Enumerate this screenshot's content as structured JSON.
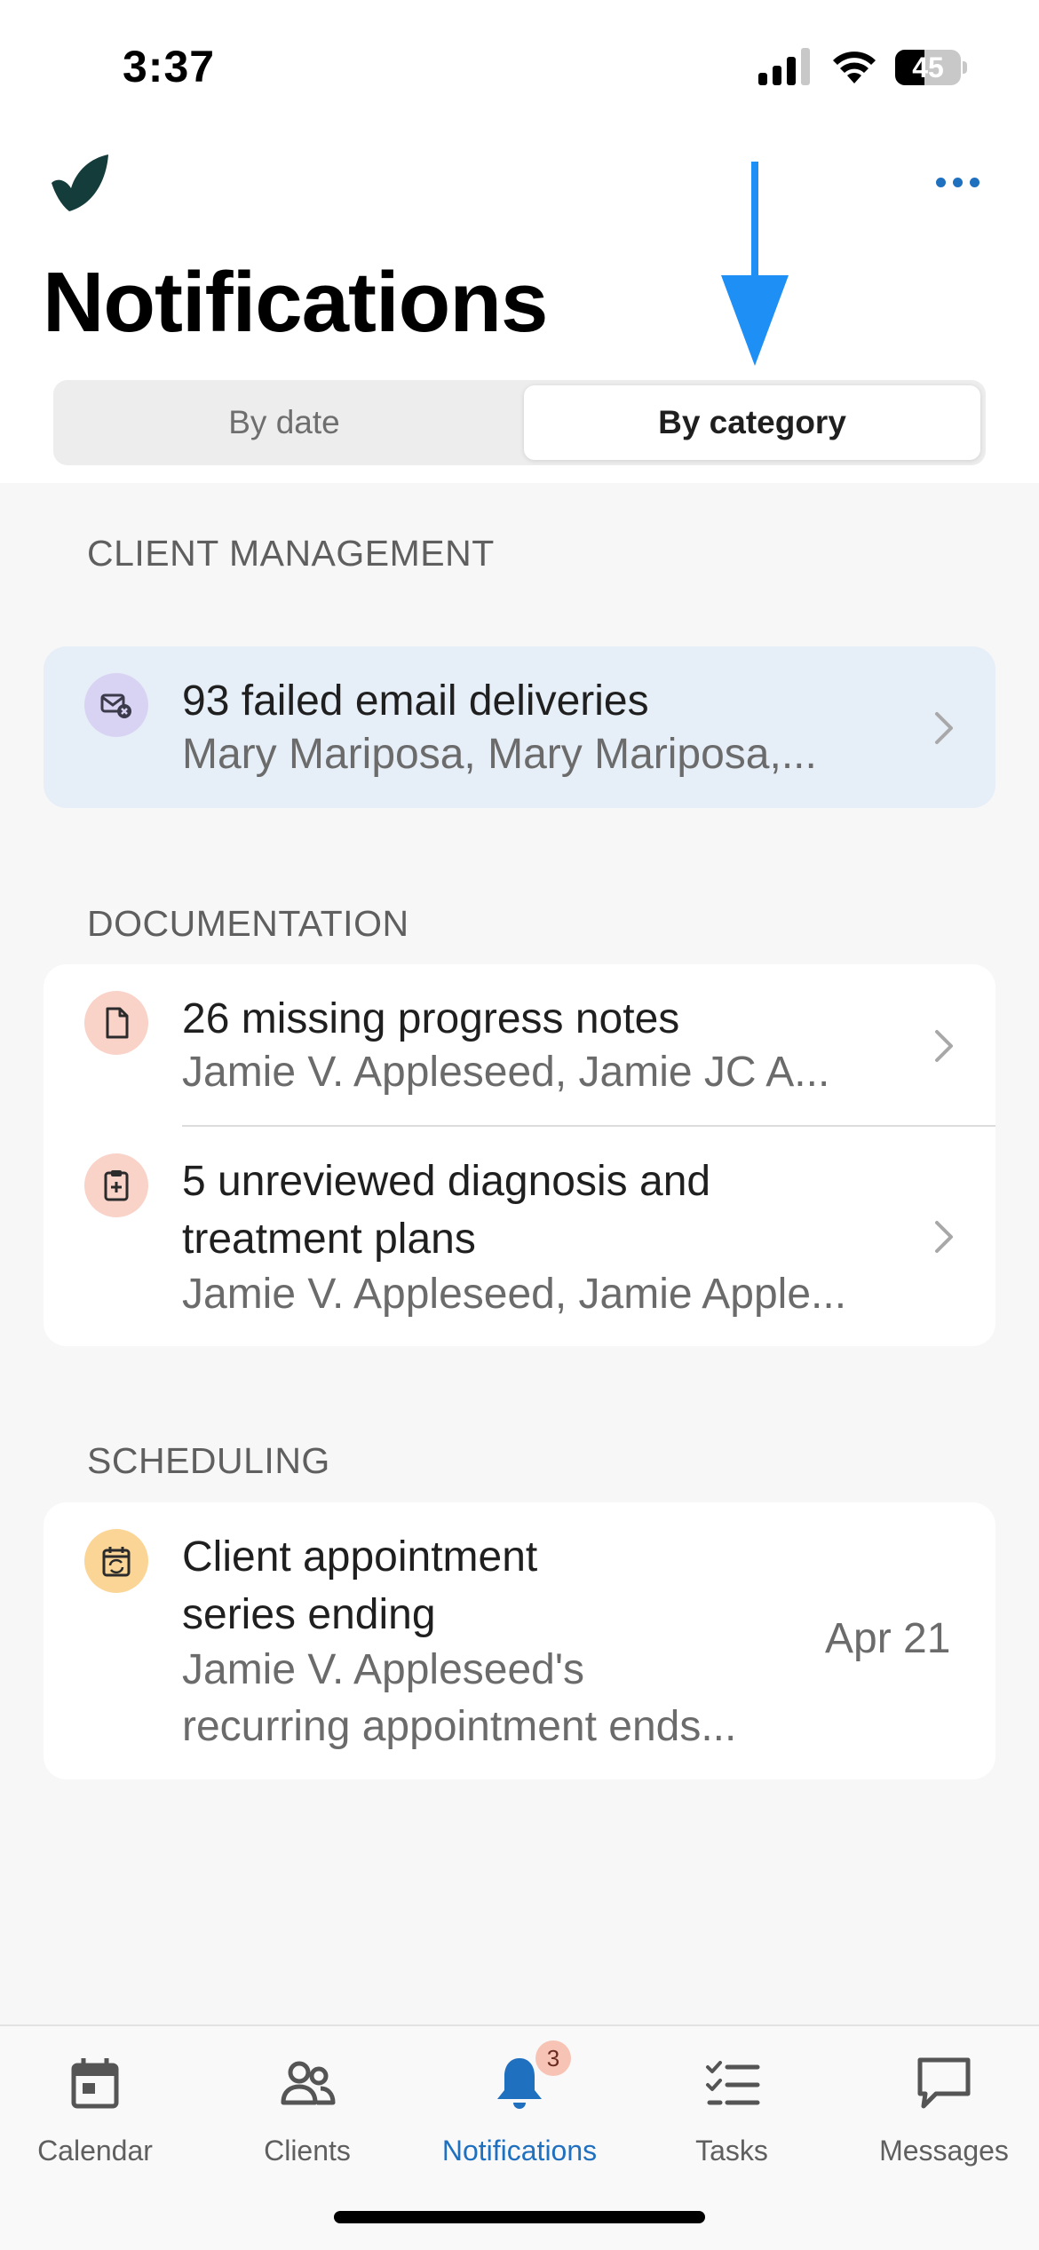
{
  "status_bar": {
    "time": "3:37",
    "battery_level": "45",
    "battery_fraction": 0.45
  },
  "header": {
    "title": "Notifications",
    "menu_icon": "more-horizontal-icon",
    "logo_icon": "app-logo-icon"
  },
  "segmented": {
    "options": [
      "By date",
      "By category"
    ],
    "selected": "By category"
  },
  "sections": [
    {
      "header": "CLIENT MANAGEMENT",
      "items": [
        {
          "icon": "mail-error-icon",
          "title": "93 failed email deliveries",
          "subtitle": "Mary Mariposa, Mary Mariposa,..."
        }
      ]
    },
    {
      "header": "DOCUMENTATION",
      "items": [
        {
          "icon": "document-icon",
          "title": "26 missing progress notes",
          "subtitle": "Jamie V. Appleseed, Jamie JC A..."
        },
        {
          "icon": "clipboard-plus-icon",
          "title_line1": "5 unreviewed diagnosis and",
          "title_line2": "treatment plans",
          "subtitle": "Jamie V. Appleseed, Jamie Apple..."
        }
      ]
    },
    {
      "header": "SCHEDULING",
      "items": [
        {
          "icon": "calendar-repeat-icon",
          "title_line1": "Client appointment",
          "title_line2": "series ending",
          "subtitle_line1": "Jamie V. Appleseed's",
          "subtitle_line2": "recurring appointment ends...",
          "date": "Apr 21"
        }
      ]
    }
  ],
  "tabbar": {
    "tabs": [
      {
        "label": "Calendar",
        "icon": "calendar-icon"
      },
      {
        "label": "Clients",
        "icon": "clients-icon"
      },
      {
        "label": "Notifications",
        "icon": "bell-icon",
        "badge": "3",
        "active": true
      },
      {
        "label": "Tasks",
        "icon": "tasks-icon"
      },
      {
        "label": "Messages",
        "icon": "message-icon"
      }
    ]
  },
  "colors": {
    "accent": "#2070c0",
    "highlight_row": "#e6eef8",
    "arrow": "#1e8ff5"
  }
}
